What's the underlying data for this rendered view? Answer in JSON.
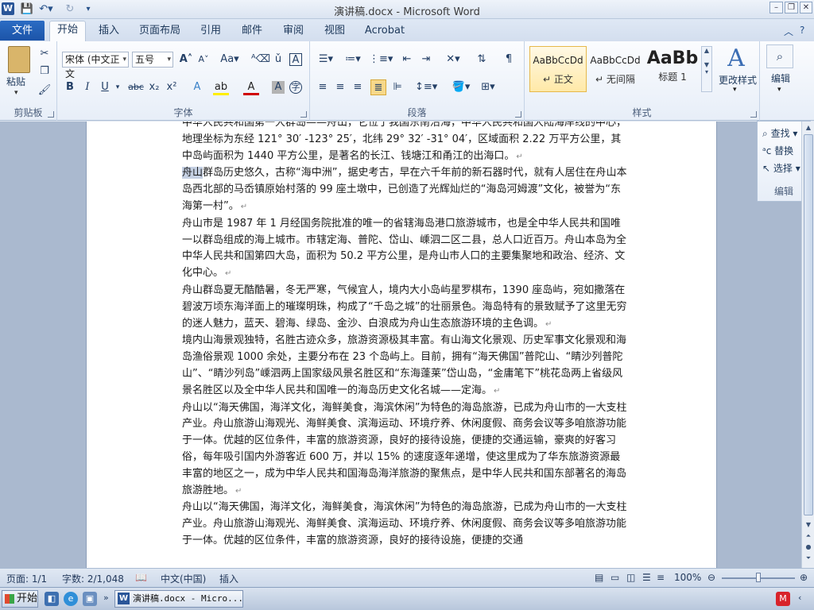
{
  "window": {
    "title": "演讲稿.docx - Microsoft Word",
    "app_icon": "W"
  },
  "ribbon_tabs": [
    "文件",
    "开始",
    "插入",
    "页面布局",
    "引用",
    "邮件",
    "审阅",
    "视图",
    "Acrobat"
  ],
  "active_tab": "开始",
  "clipboard": {
    "paste_label": "粘贴",
    "group_label": "剪贴板"
  },
  "font": {
    "name": "宋体 (中文正文",
    "size": "五号",
    "group_label": "字体",
    "aa_label": "Aa"
  },
  "paragraph": {
    "group_label": "段落"
  },
  "styles": {
    "items": [
      {
        "sample": "AaBbCcDd",
        "name": "正文",
        "selected": true
      },
      {
        "sample": "AaBbCcDd",
        "name": "无间隔",
        "selected": false
      },
      {
        "sample": "AaBb",
        "name": "标题 1",
        "selected": false
      }
    ],
    "change_styles_label": "更改样式",
    "group_label": "样式"
  },
  "editing": {
    "button_label": "编辑",
    "find_label": "查找",
    "replace_label": "替换",
    "select_label": "选择",
    "group_label": "编辑"
  },
  "document": {
    "paragraphs": [
      "中华人民共和国第一大群岛——舟山，它位于我国东南沿海，中华人民共和国大陆海岸线的中心，地理坐标为东经 121° 30′ -123° 25′，北纬 29° 32′ -31° 04′，区域面积 2.22 万平方公里，其中岛屿面积为 1440 平方公里，是著名的长江、钱塘江和甬江的出海口。",
      "群岛历史悠久，古称“海中洲”，据史考古，早在六千年前的新石器时代，就有人居住在舟山本岛西北部的马岙镇原始村落的 99 座土墩中，已创造了光辉灿烂的“海岛河姆渡”文化，被誉为“东海第一村”。",
      "舟山市是 1987 年 1 月经国务院批准的唯一的省辖海岛港口旅游城市，也是全中华人民共和国唯一以群岛组成的海上城市。市辖定海、普陀、岱山、嵊泗二区二县，总人口近百万。舟山本岛为全中华人民共和国第四大岛，面积为 50.2 平方公里，是舟山市人口的主要集聚地和政治、经济、文化中心。",
      "舟山群岛夏无酷酷暑，冬无严寒，气候宜人，境内大小岛屿星罗棋布，1390 座岛屿，宛如撒落在碧波万顷东海洋面上的璀璨明珠，构成了“千岛之城”的壮丽景色。海岛特有的景致赋予了这里无穷的迷人魅力，蓝天、碧海、绿岛、金沙、白浪成为舟山生态旅游环境的主色调。",
      "境内山海景观独特，名胜古迹众多，旅游资源极其丰富。有山海文化景观、历史军事文化景观和海岛渔俗景观 1000 余处，主要分布在 23 个岛屿上。目前，拥有“海天佛国”普陀山、“睛沙列普陀山”、“睛沙列岛”嵊泗两上国家级风景名胜区和“东海蓬莱”岱山岛，“金庸笔下”桃花岛两上省级风景名胜区以及全中华人民共和国唯一的海岛历史文化名城——定海。",
      "舟山以“海天佛国，海洋文化，海鲜美食，海滨休闲”为特色的海岛旅游，已成为舟山市的一大支柱产业。舟山旅游山海观光、海鲜美食、滨海运动、环境疗养、休闲度假、商务会议等多咱旅游功能于一体。优越的区位条件，丰富的旅游资源，良好的接待设施，便捷的交通运输，豪爽的好客习俗，每年吸引国内外游客近 600 万，并以 15% 的速度逐年递增，使这里成为了华东旅游资源最丰富的地区之一，成为中华人民共和国海岛海洋旅游的聚焦点，是中华人民共和国东部著名的海岛旅游胜地。",
      "舟山以“海天佛国，海洋文化，海鲜美食，海滨休闲”为特色的海岛旅游，已成为舟山市的一大支柱产业。舟山旅游山海观光、海鲜美食、滨海运动、环境疗养、休闲度假、商务会议等多咱旅游功能于一体。优越的区位条件，丰富的旅游资源，良好的接待设施，便捷的交通"
    ],
    "highlight_word": "舟山",
    "paragraph_mark": "↵"
  },
  "status": {
    "page": "页面: 1/1",
    "words": "字数: 2/1,048",
    "language": "中文(中国)",
    "mode": "插入",
    "zoom": "100%",
    "zoom_level_percent": 100
  },
  "taskbar": {
    "start_label": "开始",
    "word_task_label": "演讲稿.docx - Micro..."
  },
  "colors": {
    "file_tab": "#1c54a8",
    "accent": "#2a5699"
  }
}
